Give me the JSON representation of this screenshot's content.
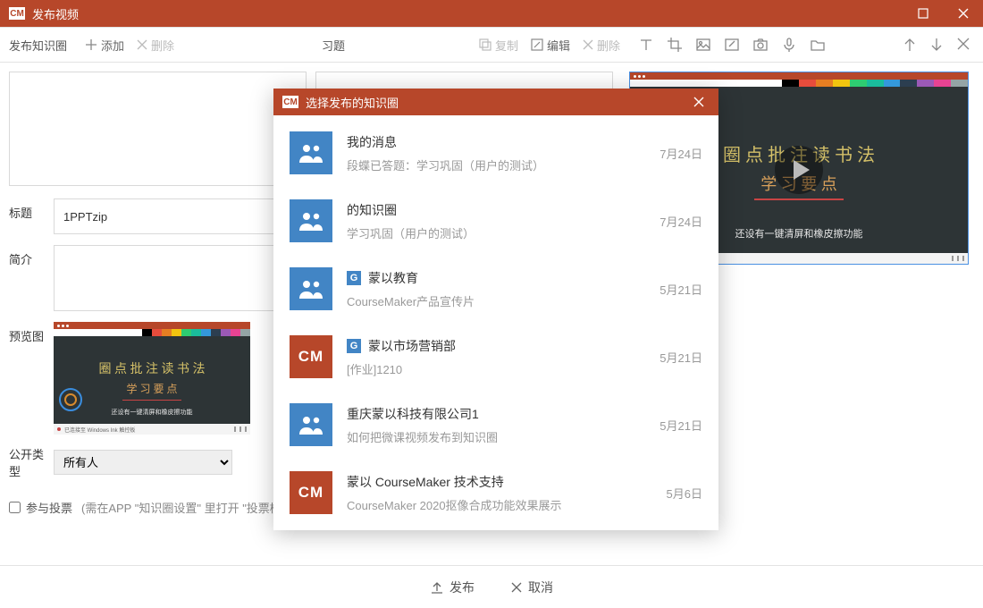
{
  "app_icon_text": "CM",
  "window_title": "发布视频",
  "toolbar": {
    "left_label": "发布知识圈",
    "add": "添加",
    "delete": "删除",
    "mid_label": "习题",
    "copy": "复制",
    "edit": "编辑"
  },
  "form": {
    "title_label": "标题",
    "title_value": "1PPTzip",
    "intro_label": "简介",
    "preview_label": "预览图",
    "open_type_label": "公开类型",
    "open_type_value": "所有人",
    "vote_label": "参与投票",
    "vote_hint": "(需在APP \"知识圈设置\" 里打开 \"投票模式\" )"
  },
  "blackboard": {
    "line1": "圈 点 批 注 读 书 法",
    "line2": "学 习 要 点",
    "caption": "还设有一键清屏和橡皮擦功能",
    "bottom_text": "已连接至 Windows Ink 触控板"
  },
  "footer": {
    "publish": "发布",
    "cancel": "取消"
  },
  "dialog": {
    "title": "选择发布的知识圈",
    "items": [
      {
        "avatar": "people",
        "badge": "",
        "name": "我的消息",
        "sub": "段蝶已答题：学习巩固（用户的测试）",
        "date": "7月24日"
      },
      {
        "avatar": "people",
        "badge": "",
        "name": "的知识圈",
        "sub": "学习巩固（用户的测试）",
        "date": "7月24日"
      },
      {
        "avatar": "people",
        "badge": "G",
        "name": "蒙以教育",
        "sub": "CourseMaker产品宣传片",
        "date": "5月21日"
      },
      {
        "avatar": "cm",
        "badge": "G",
        "name": "蒙以市场营销部",
        "sub": "[作业]1210",
        "date": "5月21日"
      },
      {
        "avatar": "people",
        "badge": "",
        "name": "重庆蒙以科技有限公司1",
        "sub": "如何把微课视频发布到知识圈",
        "date": "5月21日"
      },
      {
        "avatar": "cm",
        "badge": "",
        "name": "蒙以 CourseMaker 技术支持",
        "sub": "CourseMaker 2020抠像合成功能效果展示",
        "date": "5月6日"
      }
    ]
  },
  "colorbar": [
    "#fff",
    "#000",
    "#e74c3c",
    "#e67e22",
    "#f1c40f",
    "#2ecc71",
    "#1abc9c",
    "#3498db",
    "#2c3e50",
    "#9b59b6",
    "#e84393",
    "#95a5a6"
  ]
}
